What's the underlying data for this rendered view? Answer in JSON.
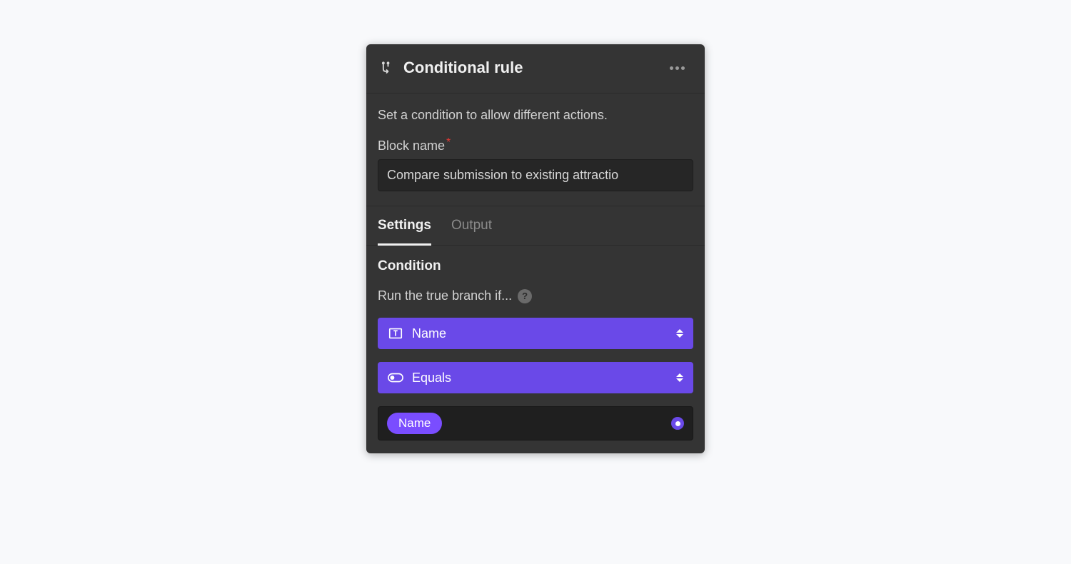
{
  "header": {
    "title": "Conditional rule"
  },
  "intro": {
    "description": "Set a condition to allow different actions.",
    "block_name_label": "Block name",
    "block_name_value": "Compare submission to existing attractio"
  },
  "tabs": {
    "settings": "Settings",
    "output": "Output"
  },
  "condition": {
    "section_title": "Condition",
    "hint": "Run the true branch if...",
    "field_select": {
      "label": "Name"
    },
    "comparator_select": {
      "label": "Equals"
    },
    "value_pill": "Name"
  }
}
